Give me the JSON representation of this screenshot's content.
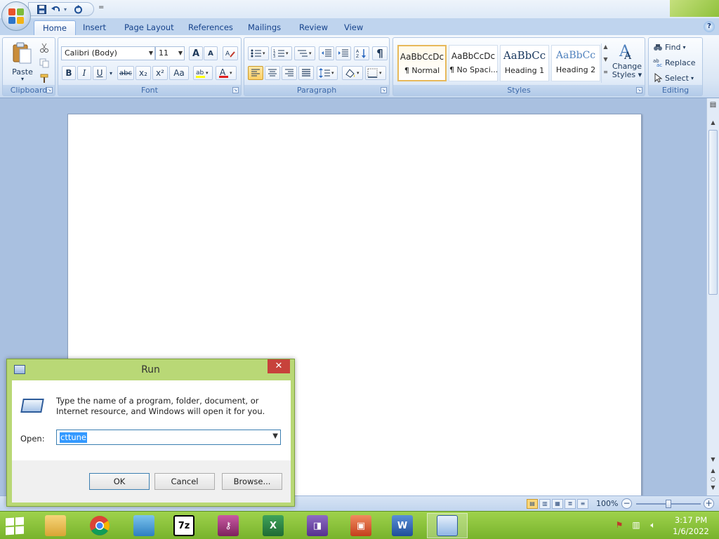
{
  "app": {
    "tabs": [
      {
        "label": "Home",
        "active": true
      },
      {
        "label": "Insert"
      },
      {
        "label": "Page Layout"
      },
      {
        "label": "References"
      },
      {
        "label": "Mailings"
      },
      {
        "label": "Review"
      },
      {
        "label": "View"
      }
    ],
    "help_glyph": "?"
  },
  "qat": {
    "save_icon": "save-icon",
    "undo_icon": "undo-icon",
    "redo_icon": "redo-icon",
    "customize_glyph": "="
  },
  "ribbon": {
    "clipboard": {
      "label": "Clipboard",
      "paste_label": "Paste",
      "paste_arrow": "▾"
    },
    "font": {
      "label": "Font",
      "font_name": "Calibri (Body)",
      "font_size": "11",
      "grow_glyph": "A",
      "shrink_glyph": "A",
      "bold": "B",
      "italic": "I",
      "underline": "U",
      "strike": "abc",
      "subscript": "x₂",
      "superscript": "x²",
      "change_case": "Aa"
    },
    "paragraph": {
      "label": "Paragraph",
      "pilcrow": "¶"
    },
    "styles": {
      "label": "Styles",
      "items": [
        {
          "sample": "AaBbCcDc",
          "name": "¶ Normal",
          "selected": true
        },
        {
          "sample": "AaBbCcDc",
          "name": "¶ No Spaci..."
        },
        {
          "sample": "AaBbCc",
          "name": "Heading 1"
        },
        {
          "sample": "AaBbCc",
          "name": "Heading 2"
        }
      ],
      "change_styles_line1": "Change",
      "change_styles_line2": "Styles"
    },
    "editing": {
      "label": "Editing",
      "find": "Find",
      "replace": "Replace",
      "select": "Select"
    }
  },
  "statusbar": {
    "zoom": "100%",
    "zoom_minus": "−",
    "zoom_plus": "+",
    "zoom_fraction": 0.5
  },
  "run_dialog": {
    "title": "Run",
    "close_glyph": "✕",
    "description": "Type the name of a program, folder, document, or Internet resource, and Windows will open it for you.",
    "open_label": "Open:",
    "open_value": "cttune",
    "ok": "OK",
    "cancel": "Cancel",
    "browse": "Browse..."
  },
  "taskbar": {
    "apps": [
      {
        "name": "file-explorer",
        "color": "#e9b949"
      },
      {
        "name": "chrome",
        "color": "#ffffff"
      },
      {
        "name": "control-panel",
        "color": "#4aa3d8"
      },
      {
        "name": "7zip",
        "color": "#ffffff",
        "label": "7z"
      },
      {
        "name": "keepass",
        "color": "#a2377d"
      },
      {
        "name": "excel",
        "color": "#1f7a3a",
        "label": "X"
      },
      {
        "name": "visio",
        "color": "#6a3fa0"
      },
      {
        "name": "powerpoint",
        "color": "#d24726"
      },
      {
        "name": "word",
        "color": "#2b579a",
        "label": "W"
      },
      {
        "name": "run",
        "color": "#9ec3ea",
        "active": true
      }
    ],
    "time": "3:17 PM",
    "date": "1/6/2022"
  }
}
